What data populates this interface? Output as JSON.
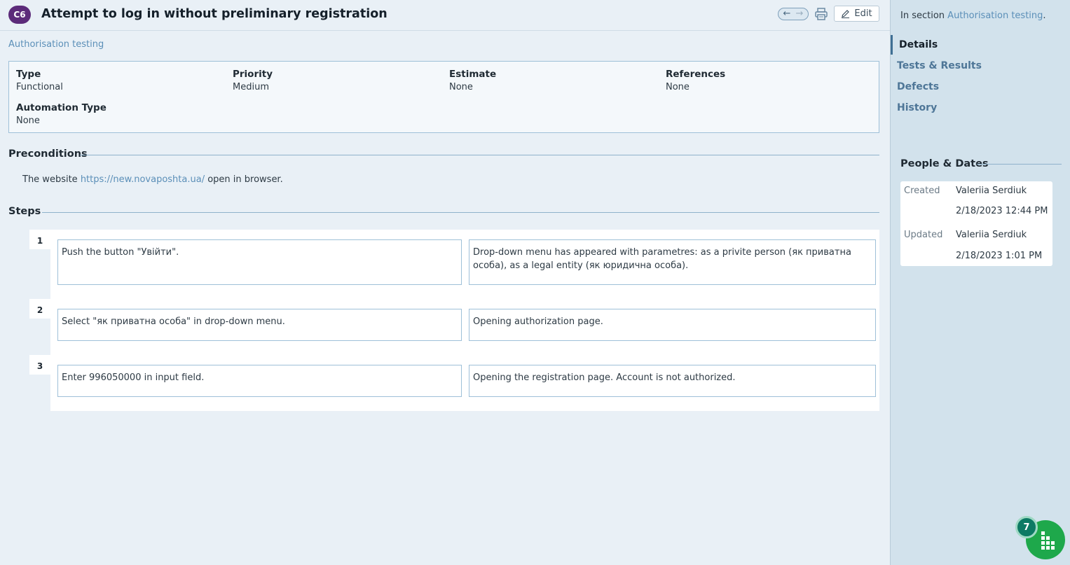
{
  "header": {
    "case_id": "C6",
    "title": "Attempt to log in without preliminary registration",
    "edit_label": "Edit",
    "nav_prev_icon": "arrow-left-icon",
    "nav_next_icon": "arrow-right-icon",
    "print_icon": "print-icon",
    "edit_icon": "pencil-icon"
  },
  "breadcrumb": "Authorisation testing",
  "details": {
    "type_label": "Type",
    "type_value": "Functional",
    "priority_label": "Priority",
    "priority_value": "Medium",
    "estimate_label": "Estimate",
    "estimate_value": "None",
    "references_label": "References",
    "references_value": "None",
    "automation_label": "Automation Type",
    "automation_value": "None"
  },
  "preconditions": {
    "heading": "Preconditions",
    "text_before": "The website ",
    "link": "https://new.novaposhta.ua/",
    "text_after": " open in browser."
  },
  "steps": {
    "heading": "Steps",
    "items": [
      {
        "number": "1",
        "action": "Push the button \"Увійти\".",
        "expected": "Drop-down menu has appeared with parametres: as a privite person (як приватна особа), as a legal entity (як юридична особа)."
      },
      {
        "number": "2",
        "action": "Select \"як приватна особа\" in drop-down menu.",
        "expected": "Opening authorization page."
      },
      {
        "number": "3",
        "action": "Enter 996050000 in input field.",
        "expected": "Opening the registration page. Account is not authorized."
      }
    ]
  },
  "sidebar": {
    "in_section_prefix": "In section ",
    "in_section_link": "Authorisation testing",
    "in_section_suffix": ".",
    "nav": [
      {
        "label": "Details",
        "active": true
      },
      {
        "label": "Tests & Results",
        "active": false
      },
      {
        "label": "Defects",
        "active": false
      },
      {
        "label": "History",
        "active": false
      }
    ],
    "people_dates_heading": "People & Dates",
    "created_label": "Created",
    "created_by": "Valeriia Serdiuk",
    "created_date": "2/18/2023 12:44 PM",
    "updated_label": "Updated",
    "updated_by": "Valeriia Serdiuk",
    "updated_date": "2/18/2023 1:01 PM"
  },
  "widget": {
    "count": "7",
    "icon": "grid-dots-icon"
  },
  "colors": {
    "badge": "#5c2b7a",
    "link": "#5b8fb8",
    "fab": "#1ea84b",
    "sidebar_bg": "#d2e2ec"
  }
}
